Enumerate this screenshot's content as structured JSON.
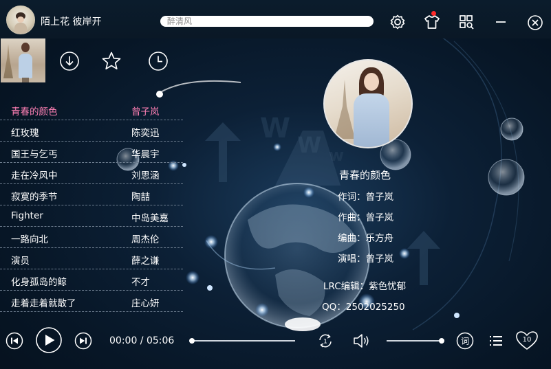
{
  "app": {
    "title": "陌上花 彼岸开"
  },
  "search": {
    "placeholder": "醉清风"
  },
  "toolbar_icons": [
    "settings-gear-icon",
    "skin-shirt-icon",
    "app-grid-search-icon",
    "minimize-icon",
    "close-icon"
  ],
  "nav_icons": [
    "download-icon",
    "favorite-star-icon",
    "history-clock-icon"
  ],
  "playlist": [
    {
      "song": "青春的颜色",
      "artist": "曾子岚",
      "active": true
    },
    {
      "song": "红玫瑰",
      "artist": "陈奕迅"
    },
    {
      "song": "国王与乞丐",
      "artist": "华晨宇"
    },
    {
      "song": "走在冷风中",
      "artist": "刘思涵"
    },
    {
      "song": "寂寞的季节",
      "artist": "陶喆"
    },
    {
      "song": "Fighter",
      "artist": "中岛美嘉"
    },
    {
      "song": "一路向北",
      "artist": "周杰伦"
    },
    {
      "song": "演员",
      "artist": "薛之谦"
    },
    {
      "song": "化身孤岛的鲸",
      "artist": "不才"
    },
    {
      "song": "走着走着就散了",
      "artist": "庄心妍"
    }
  ],
  "now_playing": {
    "title": "青春的颜色",
    "lyricist": "作词：曾子岚",
    "composer": "作曲：曾子岚",
    "arranger": "编曲：乐方舟",
    "singer": "演唱：曾子岚",
    "lrc_editor": "LRC编辑：紫色忧郁",
    "qq": "QQ：2502025250"
  },
  "player": {
    "current_time": "00:00",
    "total_time": "05:06",
    "time_display": "00:00 / 05:06",
    "progress": 0.0,
    "volume": 1.0,
    "like_count": "10",
    "lyrics_label": "词"
  },
  "colors": {
    "active_song": "#ff80b5",
    "background": "#0a1a2b",
    "notification_dot": "#ff2a2a"
  }
}
